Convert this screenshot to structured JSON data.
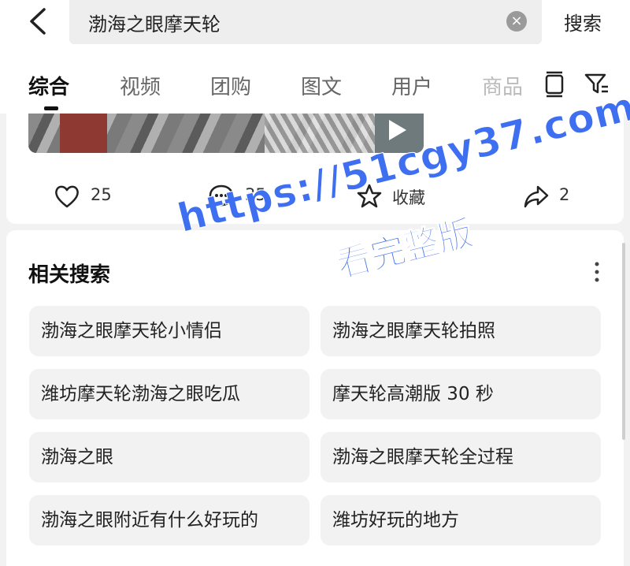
{
  "search": {
    "query": "渤海之眼摩天轮",
    "clear_icon": "clear-icon",
    "button_label": "搜索"
  },
  "tabs": [
    {
      "label": "综合",
      "active": true
    },
    {
      "label": "视频"
    },
    {
      "label": "团购"
    },
    {
      "label": "图文"
    },
    {
      "label": "用户"
    },
    {
      "label": "商品"
    }
  ],
  "tab_icons": [
    "layout-icon",
    "filter-icon"
  ],
  "post": {
    "likes": "25",
    "comments": "35",
    "favorite_label": "收藏",
    "shares": "2"
  },
  "related": {
    "title": "相关搜索",
    "items": [
      "渤海之眼摩天轮小情侣",
      "渤海之眼摩天轮拍照",
      "潍坊摩天轮渤海之眼吃瓜",
      "摩天轮高潮版 30 秒",
      "渤海之眼",
      "渤海之眼摩天轮全过程",
      "渤海之眼附近有什么好玩的",
      "潍坊好玩的地方"
    ]
  },
  "watermark": {
    "line1": "https://51cgy37.com",
    "line2": "看完整版"
  },
  "colors": {
    "watermark": "#3d6ff0",
    "accent_text": "#111111",
    "muted_text": "#666666"
  }
}
